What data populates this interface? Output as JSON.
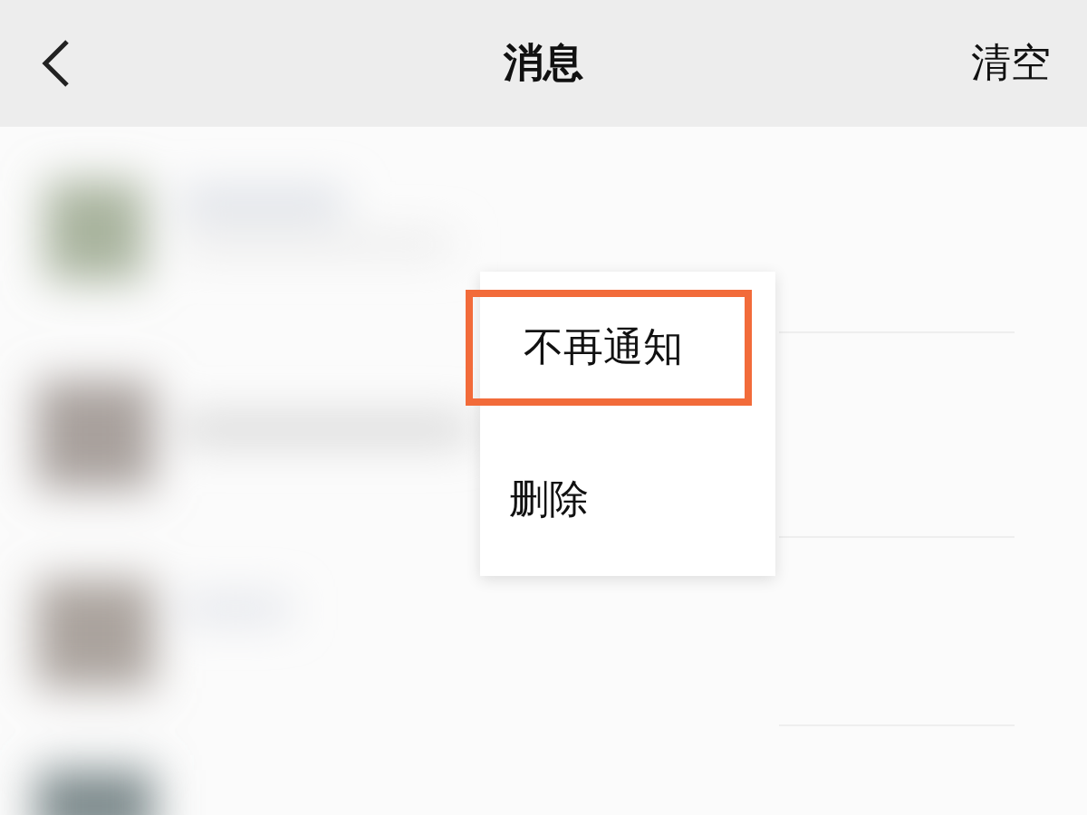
{
  "header": {
    "title": "消息",
    "action": "清空"
  },
  "context_menu": {
    "items": [
      {
        "label": "不再通知",
        "highlighted": true
      },
      {
        "label": "删除",
        "highlighted": false
      }
    ]
  }
}
